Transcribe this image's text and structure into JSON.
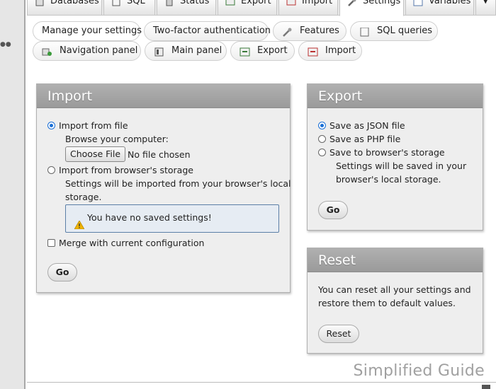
{
  "top_tabs": [
    {
      "label": "Databases",
      "icon": "database-icon"
    },
    {
      "label": "SQL",
      "icon": "sql-icon"
    },
    {
      "label": "Status",
      "icon": "status-icon"
    },
    {
      "label": "Export",
      "icon": "export-icon"
    },
    {
      "label": "Import",
      "icon": "import-icon"
    },
    {
      "label": "Settings",
      "icon": "wrench-icon",
      "active": true
    },
    {
      "label": "Variables",
      "icon": "variables-icon"
    }
  ],
  "sub_tabs": [
    {
      "label": "Manage your settings",
      "active": true
    },
    {
      "label": "Two-factor authentication"
    },
    {
      "label": "Features",
      "icon": "wrench-icon"
    },
    {
      "label": "SQL queries",
      "icon": "sql-icon"
    },
    {
      "label": "Navigation panel",
      "icon": "navigation-icon"
    },
    {
      "label": "Main panel",
      "icon": "main-panel-icon"
    },
    {
      "label": "Export",
      "icon": "export-icon"
    },
    {
      "label": "Import",
      "icon": "import-icon"
    }
  ],
  "import_panel": {
    "title": "Import",
    "from_file_label": "Import from file",
    "browse_label": "Browse your computer:",
    "choose_file_label": "Choose File",
    "no_file_label": "No file chosen",
    "from_storage_label": "Import from browser's storage",
    "storage_desc_line1": "Settings will be imported from your browser's local",
    "storage_desc_line2": "storage.",
    "notice": "You have no saved settings!",
    "merge_label": "Merge with current configuration",
    "go_label": "Go"
  },
  "export_panel": {
    "title": "Export",
    "options": [
      "Save as JSON file",
      "Save as PHP file",
      "Save to browser's storage"
    ],
    "selected": "Save as JSON file",
    "desc_line1": "Settings will be saved in your",
    "desc_line2": "browser's local storage.",
    "go_label": "Go"
  },
  "reset_panel": {
    "title": "Reset",
    "desc_line1": "You can reset all your settings and",
    "desc_line2": "restore them to default values.",
    "reset_label": "Reset"
  },
  "watermark": "Simplified Guide",
  "colors": {
    "accent": "#1a6fd6",
    "panel_header": "#a6a6a6",
    "notice_border": "#5b7fa7"
  }
}
